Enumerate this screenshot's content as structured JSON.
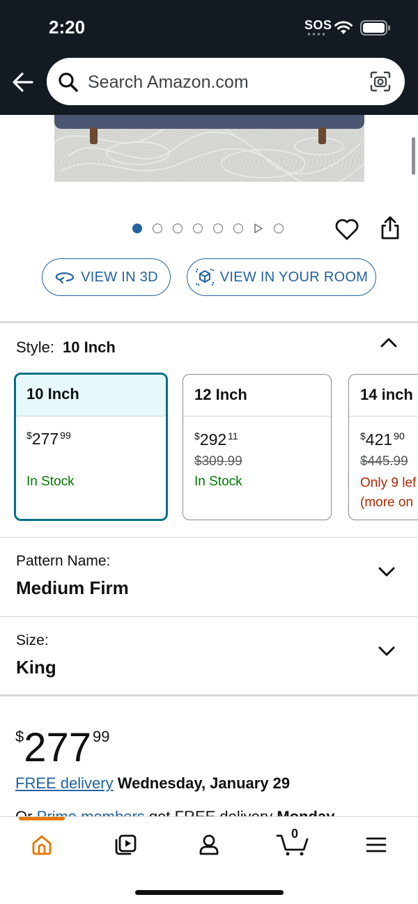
{
  "status_bar": {
    "time": "2:20",
    "sos": "SOS"
  },
  "header": {
    "search_placeholder": "Search Amazon.com",
    "icons": [
      "back-arrow-icon",
      "search-icon",
      "camera-icon"
    ]
  },
  "gallery": {
    "dot_count": 8,
    "active_dot": 0,
    "view_3d_label": "VIEW IN 3D",
    "view_room_label": "VIEW IN YOUR ROOM"
  },
  "style_selector": {
    "label": "Style:",
    "selected": "10 Inch",
    "options": [
      {
        "name": "10 Inch",
        "price_symbol": "$",
        "price_whole": "277",
        "price_fraction": "99",
        "list_price": "",
        "stock": "In Stock",
        "low_stock": []
      },
      {
        "name": "12 Inch",
        "price_symbol": "$",
        "price_whole": "292",
        "price_fraction": "11",
        "list_price": "$309.99",
        "stock": "In Stock",
        "low_stock": []
      },
      {
        "name": "14 inch",
        "price_symbol": "$",
        "price_whole": "421",
        "price_fraction": "90",
        "list_price": "$445.99",
        "stock": "",
        "low_stock": [
          "Only 9 lef",
          "(more on"
        ]
      }
    ]
  },
  "pattern": {
    "label": "Pattern Name:",
    "value": "Medium Firm"
  },
  "size": {
    "label": "Size:",
    "value": "King"
  },
  "price": {
    "symbol": "$",
    "whole": "277",
    "fraction": "99"
  },
  "delivery": {
    "link": "FREE delivery",
    "date": "Wednesday, January 29",
    "prime_prefix": "Or ",
    "prime_link": "Prime members",
    "prime_suffix": " get FREE delivery ",
    "prime_day": "Monday"
  },
  "tabbar": {
    "items": [
      "home-icon",
      "video-icon",
      "account-icon",
      "cart-icon",
      "menu-icon"
    ],
    "cart_count": "0",
    "accent": "#e77600"
  },
  "colors": {
    "header_bg": "#131a22",
    "link": "#2162a1",
    "selected_border": "#007185",
    "in_stock": "#007600",
    "low_stock": "#b12704"
  }
}
